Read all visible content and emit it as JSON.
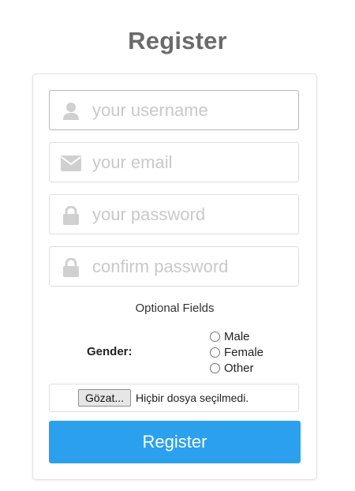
{
  "title": "Register",
  "fields": [
    {
      "placeholder": "your username",
      "value": "",
      "icon": "user-icon"
    },
    {
      "placeholder": "your email",
      "value": "",
      "icon": "envelope-icon"
    },
    {
      "placeholder": "your password",
      "value": "",
      "icon": "lock-icon"
    },
    {
      "placeholder": "confirm password",
      "value": "",
      "icon": "lock-icon"
    }
  ],
  "optional_label": "Optional Fields",
  "gender": {
    "label": "Gender:",
    "options": [
      "Male",
      "Female",
      "Other"
    ]
  },
  "file": {
    "button_label": "Gözat...",
    "status": "Hiçbir dosya seçilmedi."
  },
  "submit_label": "Register",
  "colors": {
    "accent": "#2ba1ee",
    "title": "#6b6b6b",
    "icon": "#d0d0d0",
    "placeholder": "#c9c9c9"
  }
}
